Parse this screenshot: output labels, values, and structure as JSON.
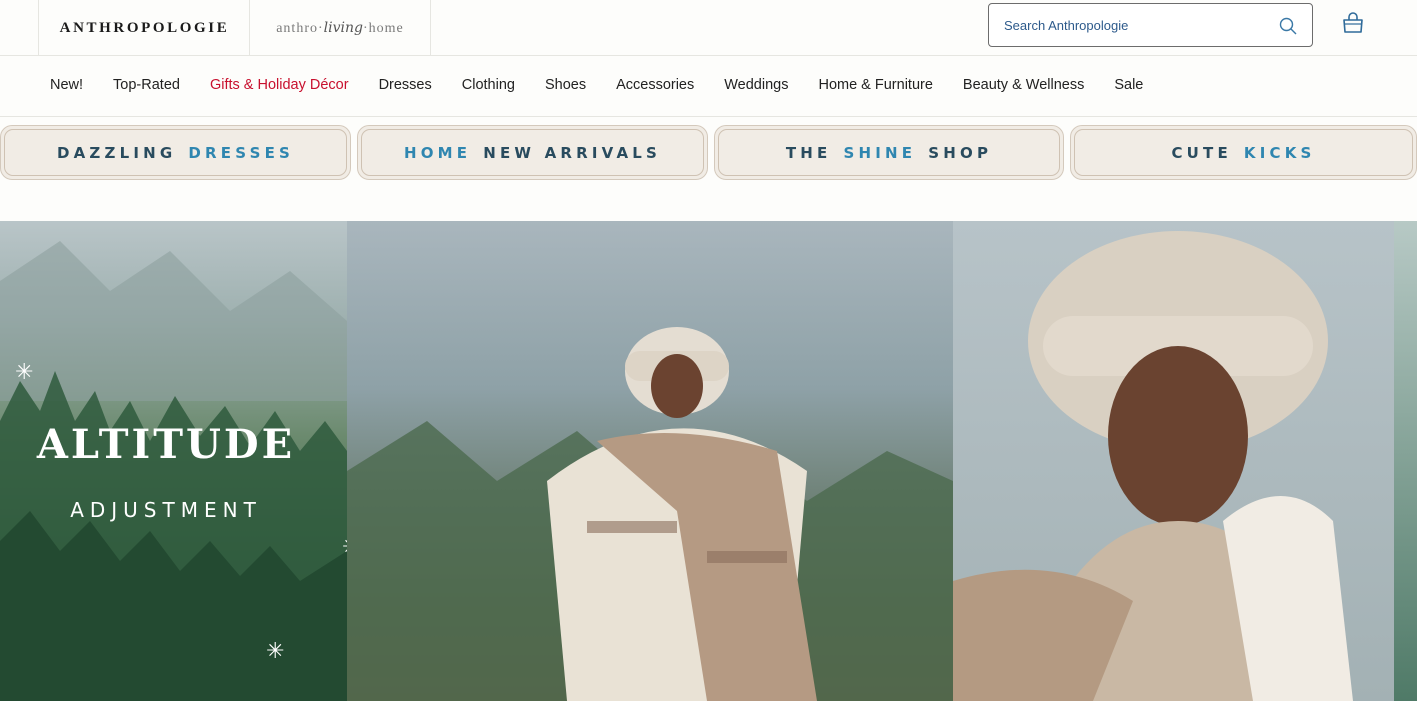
{
  "header": {
    "brand": "ANTHROPOLOGIE",
    "sub_brand_left": "anthro",
    "sub_brand_mid": "living",
    "sub_brand_right": "home",
    "search_placeholder": "Search Anthropologie"
  },
  "nav": {
    "items": [
      {
        "label": "New!"
      },
      {
        "label": "Top-Rated"
      },
      {
        "label": "Gifts & Holiday Décor"
      },
      {
        "label": "Dresses"
      },
      {
        "label": "Clothing"
      },
      {
        "label": "Shoes"
      },
      {
        "label": "Accessories"
      },
      {
        "label": "Weddings"
      },
      {
        "label": "Home & Furniture"
      },
      {
        "label": "Beauty & Wellness"
      },
      {
        "label": "Sale"
      }
    ]
  },
  "promos": [
    {
      "first": "DAZZLING",
      "second": "DRESSES"
    },
    {
      "first": "HOME",
      "second": "NEW ARRIVALS"
    },
    {
      "first": "THE",
      "second": "SHINE",
      "third": "SHOP"
    },
    {
      "first": "CUTE",
      "second": "KICKS"
    }
  ],
  "hero": {
    "title": "ALTITUDE",
    "subtitle": "ADJUSTMENT"
  },
  "colors": {
    "accent_red": "#c8102e",
    "promo_blue": "#2f86b0",
    "promo_navy": "#294b5e"
  }
}
